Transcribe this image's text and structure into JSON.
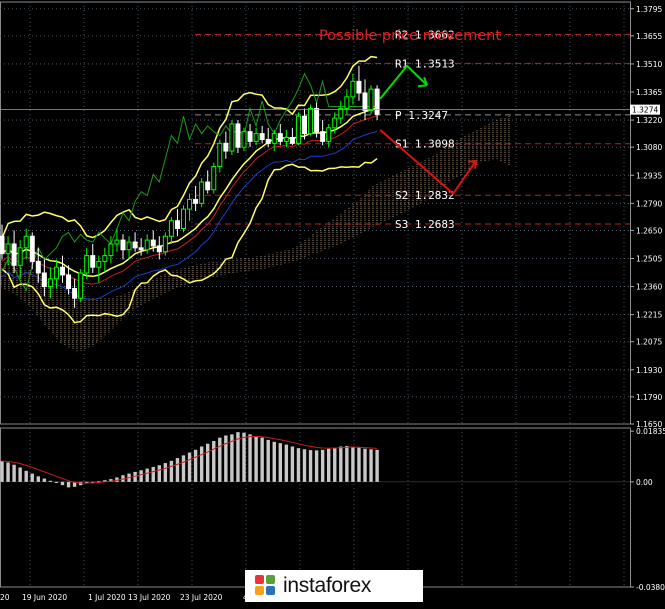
{
  "chart_data": {
    "type": "candlestick",
    "title": "Possible price movement",
    "price_axis": {
      "range": [
        1.165,
        1.383
      ],
      "ticks": [
        "1.3795",
        "1.3655",
        "1.3510",
        "1.3365",
        "1.3220",
        "1.3080",
        "1.2935",
        "1.2790",
        "1.2650",
        "1.2505",
        "1.2360",
        "1.2215",
        "1.2075",
        "1.1930",
        "1.1790",
        "1.1650"
      ],
      "current_price": "1.3274"
    },
    "macd_axis": {
      "range": [
        -0.03807,
        0.0195
      ],
      "ticks": [
        "0.01835",
        "0.00",
        "-0.03807"
      ]
    },
    "date_labels": [
      "20",
      "19 Jun 2020",
      "1 Jul 2020",
      "13 Jul 2020",
      "23 Jul 2020",
      "4 A"
    ],
    "levels": [
      {
        "name": "R2",
        "value": 1.3662,
        "label": "R2 1.3662",
        "color": "#b22222",
        "style": "dashed"
      },
      {
        "name": "R1",
        "value": 1.3513,
        "label": "R1 1.3513",
        "color": "#b22222",
        "style": "dashed"
      },
      {
        "name": "P",
        "value": 1.3247,
        "label": "P 1.3247",
        "color": "#888888",
        "style": "dashed"
      },
      {
        "name": "S1",
        "value": 1.3098,
        "label": "S1 1.3098",
        "color": "#b22222",
        "style": "dashed"
      },
      {
        "name": "S2",
        "value": 1.2832,
        "label": "S2 1.2832",
        "color": "#b22222",
        "style": "dashed"
      },
      {
        "name": "S3",
        "value": 1.2683,
        "label": "S3 1.2683",
        "color": "#b22222",
        "style": "dashed"
      }
    ],
    "ohlc": [
      [
        1.262,
        1.268,
        1.25,
        1.253
      ],
      [
        1.253,
        1.262,
        1.247,
        1.258
      ],
      [
        1.258,
        1.265,
        1.243,
        1.247
      ],
      [
        1.247,
        1.26,
        1.24,
        1.256
      ],
      [
        1.256,
        1.266,
        1.25,
        1.262
      ],
      [
        1.262,
        1.264,
        1.245,
        1.249
      ],
      [
        1.249,
        1.256,
        1.238,
        1.243
      ],
      [
        1.243,
        1.25,
        1.231,
        1.236
      ],
      [
        1.236,
        1.246,
        1.23,
        1.24
      ],
      [
        1.24,
        1.25,
        1.235,
        1.246
      ],
      [
        1.246,
        1.252,
        1.238,
        1.242
      ],
      [
        1.242,
        1.247,
        1.232,
        1.235
      ],
      [
        1.235,
        1.24,
        1.225,
        1.23
      ],
      [
        1.23,
        1.245,
        1.228,
        1.243
      ],
      [
        1.243,
        1.256,
        1.24,
        1.252
      ],
      [
        1.252,
        1.258,
        1.243,
        1.246
      ],
      [
        1.246,
        1.252,
        1.238,
        1.249
      ],
      [
        1.249,
        1.256,
        1.244,
        1.252
      ],
      [
        1.252,
        1.262,
        1.248,
        1.258
      ],
      [
        1.258,
        1.266,
        1.254,
        1.26
      ],
      [
        1.26,
        1.263,
        1.25,
        1.255
      ],
      [
        1.255,
        1.262,
        1.25,
        1.259
      ],
      [
        1.259,
        1.264,
        1.254,
        1.256
      ],
      [
        1.256,
        1.261,
        1.252,
        1.255
      ],
      [
        1.255,
        1.263,
        1.253,
        1.26
      ],
      [
        1.26,
        1.265,
        1.254,
        1.257
      ],
      [
        1.257,
        1.262,
        1.25,
        1.254
      ],
      [
        1.254,
        1.264,
        1.252,
        1.262
      ],
      [
        1.262,
        1.272,
        1.258,
        1.27
      ],
      [
        1.27,
        1.276,
        1.262,
        1.266
      ],
      [
        1.266,
        1.278,
        1.264,
        1.276
      ],
      [
        1.276,
        1.284,
        1.27,
        1.281
      ],
      [
        1.281,
        1.288,
        1.275,
        1.279
      ],
      [
        1.279,
        1.292,
        1.277,
        1.29
      ],
      [
        1.29,
        1.296,
        1.284,
        1.286
      ],
      [
        1.286,
        1.3,
        1.284,
        1.298
      ],
      [
        1.298,
        1.312,
        1.295,
        1.31
      ],
      [
        1.31,
        1.316,
        1.302,
        1.306
      ],
      [
        1.306,
        1.322,
        1.304,
        1.32
      ],
      [
        1.32,
        1.322,
        1.305,
        1.308
      ],
      [
        1.308,
        1.318,
        1.306,
        1.316
      ],
      [
        1.316,
        1.32,
        1.308,
        1.311
      ],
      [
        1.311,
        1.318,
        1.309,
        1.315
      ],
      [
        1.315,
        1.319,
        1.31,
        1.312
      ],
      [
        1.312,
        1.318,
        1.308,
        1.31
      ],
      [
        1.31,
        1.317,
        1.306,
        1.315
      ],
      [
        1.315,
        1.32,
        1.309,
        1.311
      ],
      [
        1.311,
        1.317,
        1.308,
        1.313
      ],
      [
        1.313,
        1.318,
        1.309,
        1.31
      ],
      [
        1.31,
        1.326,
        1.309,
        1.324
      ],
      [
        1.324,
        1.328,
        1.312,
        1.315
      ],
      [
        1.315,
        1.33,
        1.314,
        1.328
      ],
      [
        1.328,
        1.331,
        1.313,
        1.316
      ],
      [
        1.316,
        1.322,
        1.309,
        1.311
      ],
      [
        1.311,
        1.32,
        1.308,
        1.318
      ],
      [
        1.318,
        1.326,
        1.315,
        1.323
      ],
      [
        1.323,
        1.332,
        1.32,
        1.328
      ],
      [
        1.328,
        1.338,
        1.325,
        1.334
      ],
      [
        1.334,
        1.346,
        1.33,
        1.342
      ],
      [
        1.342,
        1.35,
        1.332,
        1.336
      ],
      [
        1.336,
        1.343,
        1.322,
        1.327
      ],
      [
        1.327,
        1.34,
        1.325,
        1.338
      ],
      [
        1.338,
        1.34,
        1.322,
        1.325
      ]
    ],
    "macd_hist": [
      0.0075,
      0.007,
      0.0062,
      0.0052,
      0.004,
      0.003,
      0.002,
      0.0012,
      0.0004,
      -0.0004,
      -0.0012,
      -0.002,
      -0.0018,
      -0.0012,
      -0.0006,
      -0.0002,
      0.0002,
      0.0006,
      0.001,
      0.0016,
      0.0024,
      0.003,
      0.0036,
      0.0042,
      0.0048,
      0.0054,
      0.006,
      0.0068,
      0.0076,
      0.0086,
      0.0096,
      0.0106,
      0.0116,
      0.0128,
      0.0138,
      0.0148,
      0.016,
      0.0168,
      0.0172,
      0.018,
      0.0178,
      0.0172,
      0.0166,
      0.016,
      0.0152,
      0.0145,
      0.014,
      0.0135,
      0.0128,
      0.0122,
      0.0118,
      0.0115,
      0.0114,
      0.0116,
      0.012,
      0.0124,
      0.0128,
      0.013,
      0.0128,
      0.0124,
      0.012,
      0.0118,
      0.0116
    ],
    "colors": {
      "background": "#000000",
      "grid": "#5a6a7a",
      "candle_up": "#00ff00",
      "candle_down": "#ffffff",
      "bollinger": "#ffff66",
      "tenkan": "#c81e1e",
      "kijun": "#1e3cc8",
      "chikou": "#1e9b1e",
      "cloud": "#c8a88a",
      "arrow_up": "#00dd00",
      "arrow_down": "#dd1111",
      "title": "#e02020"
    }
  },
  "watermark": {
    "brand": "instaforex"
  }
}
